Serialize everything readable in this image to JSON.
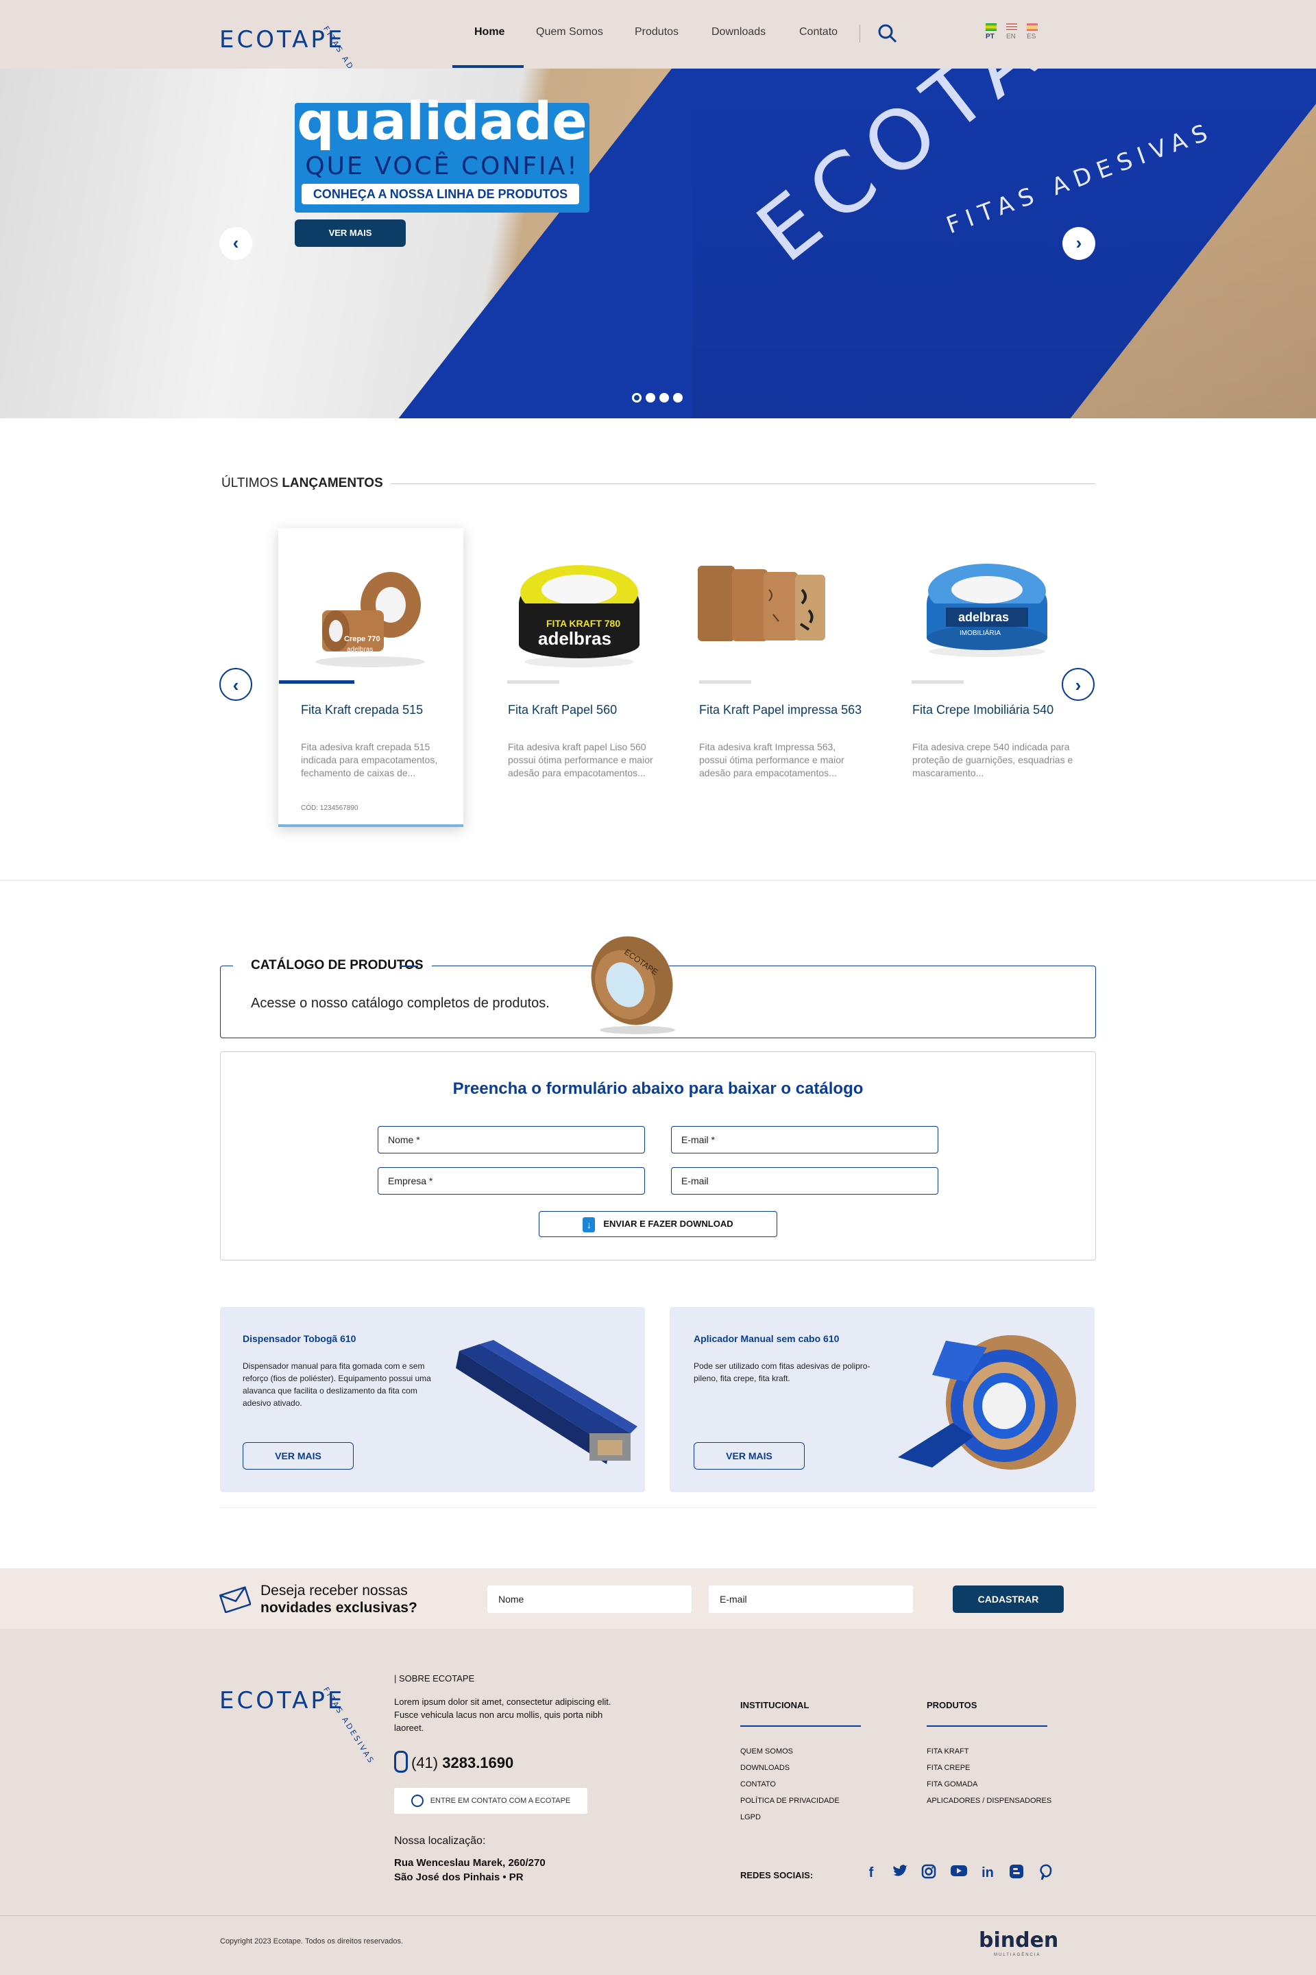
{
  "header": {
    "logo": "ECOTAPE",
    "logo_tagline": "FITAS ADESIVAS",
    "nav": [
      "Home",
      "Quem Somos",
      "Produtos",
      "Downloads",
      "Contato"
    ],
    "languages": [
      "PT",
      "EN",
      "ES"
    ],
    "search_icon": "search-icon"
  },
  "hero": {
    "title": "qualidade",
    "subtitle": "QUE VOCÊ CONFIA!",
    "pill": "CONHEÇA A NOSSA LINHA DE PRODUTOS",
    "button": "VER MAIS",
    "photo_brand": "ECOTAPE",
    "photo_tagline": "FITAS ADESIVAS",
    "slides": 4,
    "active_slide": 1
  },
  "launches": {
    "title_prefix": "ÚLTIMOS",
    "title_bold": "LANÇAMENTOS",
    "products": [
      {
        "name": "Fita Kraft crepada 515",
        "desc": "Fita adesiva kraft crepada 515 indicada para empacotamentos, fechamento de caixas de...",
        "code": "CÓD: 1234567890"
      },
      {
        "name": "Fita Kraft Papel 560",
        "desc": "Fita adesiva kraft papel Liso 560 possui ótima performance e maior adesão para empacotamentos..."
      },
      {
        "name": "Fita Kraft Papel impressa 563",
        "desc": "Fita adesiva kraft Impressa 563, possui ótima performance e maior adesão para empacotamentos..."
      },
      {
        "name": "Fita Crepe Imobiliária 540",
        "desc": "Fita adesiva crepe 540 indicada para proteção de guarnições, esquadrias e mascaramento..."
      }
    ],
    "product_labels": [
      "Crepe 770",
      "adelbras",
      "FITA KRAFT 780",
      "IMOBILIÁRIA"
    ]
  },
  "catalog": {
    "title": "CATÁLOGO DE PRODUTOS",
    "text": "Acesse o nosso catálogo completos de produtos.",
    "form_title": "Preencha o formulário abaixo para baixar o catálogo",
    "fields": {
      "name": "Nome *",
      "email_req": "E-mail *",
      "company": "Empresa *",
      "email": "E-mail"
    },
    "button": "ENVIAR E FAZER DOWNLOAD"
  },
  "promos": [
    {
      "title": "Dispensador Tobogã 610",
      "desc": "Dispensador manual para fita gomada com e sem reforço (fios de poliéster). Equipamento possui uma alavanca que facilita o deslizamento da fita com adesivo ativado.",
      "button": "VER MAIS"
    },
    {
      "title": "Aplicador Manual sem cabo 610",
      "desc": "Pode ser utilizado com fitas adesivas de polipro- pileno, fita crepe, fita kraft.",
      "button": "VER MAIS"
    }
  ],
  "newsletter": {
    "title_line1": "Deseja receber nossas",
    "title_line2": "novidades exclusivas?",
    "name_placeholder": "Nome",
    "email_placeholder": "E-mail",
    "button": "CADASTRAR"
  },
  "footer": {
    "about_title": "| SOBRE ECOTAPE",
    "about_text": "Lorem ipsum dolor sit amet, consectetur adipiscing elit. Fusce vehicula lacus non arcu mollis, quis porta nibh laoreet.",
    "phone": "(41) 3283.1690",
    "phone_prefix": "(41)",
    "phone_number": "3283.1690",
    "whatsapp": "ENTRE EM CONTATO COM A ECOTAPE",
    "location_title": "Nossa localização:",
    "address_line1": "Rua Wenceslau Marek, 260/270",
    "address_line2": "São José dos Pinhais • PR",
    "institucional_title": "INSTITUCIONAL",
    "institucional": [
      "QUEM SOMOS",
      "DOWNLOADS",
      "CONTATO",
      "POLÍTICA DE PRIVACIDADE",
      "LGPD"
    ],
    "produtos_title": "PRODUTOS",
    "produtos": [
      "FITA KRAFT",
      "FITA CREPE",
      "FITA GOMADA",
      "APLICADORES / DISPENSADORES"
    ],
    "social_title": "REDES SOCIAIS:",
    "social_icons": [
      "facebook-icon",
      "twitter-icon",
      "instagram-icon",
      "youtube-icon",
      "linkedin-icon",
      "blogger-icon",
      "pinterest-icon"
    ],
    "copyright": "Copyright 2023 Ecotape. Todos os direitos reservados.",
    "agency": "binden",
    "agency_sub": "MULTIAGÊNCIA"
  },
  "colors": {
    "primary": "#0b3d91",
    "dark_button": "#0b3d66",
    "header_bg": "#e8dfda",
    "accent": "#1a86d8"
  }
}
